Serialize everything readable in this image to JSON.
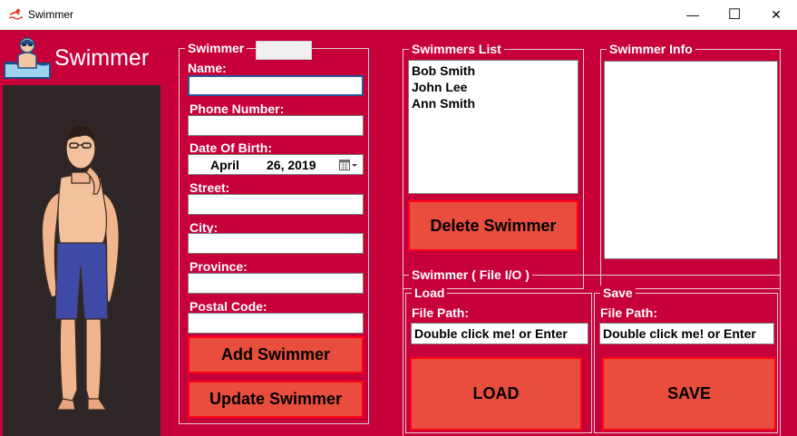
{
  "window": {
    "title": "Swimmer",
    "minimize_glyph": "—",
    "maximize_glyph": "☐",
    "close_glyph": "✕"
  },
  "logo": {
    "text": "Swimmer",
    "icon": "swimmer-avatar-icon"
  },
  "form_group": {
    "title": "Swimmer",
    "name_label": "Name:",
    "name_value": "",
    "phone_label": "Phone Number:",
    "phone_value": "",
    "dob_label": "Date Of Birth:",
    "dob_month": "April",
    "dob_day_year": "26, 2019",
    "street_label": "Street:",
    "street_value": "",
    "city_label": "City:",
    "city_value": "",
    "province_label": "Province:",
    "province_value": "",
    "postal_label": "Postal Code:",
    "postal_value": "",
    "add_button": "Add Swimmer",
    "update_button": "Update Swimmer"
  },
  "list_group": {
    "title": "Swimmers List",
    "items": [
      "Bob Smith",
      "John Lee",
      "Ann Smith"
    ],
    "delete_button": "Delete Swimmer"
  },
  "info_group": {
    "title": "Swimmer Info"
  },
  "file_group": {
    "title": "Swimmer ( File I/O )",
    "load": {
      "title": "Load",
      "path_label": "File Path:",
      "path_value": "Double click me! or Enter",
      "button": "LOAD"
    },
    "save": {
      "title": "Save",
      "path_label": "File Path:",
      "path_value": "Double click me! or Enter",
      "button": "SAVE"
    }
  },
  "colors": {
    "background": "#c8003a",
    "button_fill": "#e84d3d",
    "button_border": "#ff0018",
    "image_panel": "#2e2626"
  }
}
